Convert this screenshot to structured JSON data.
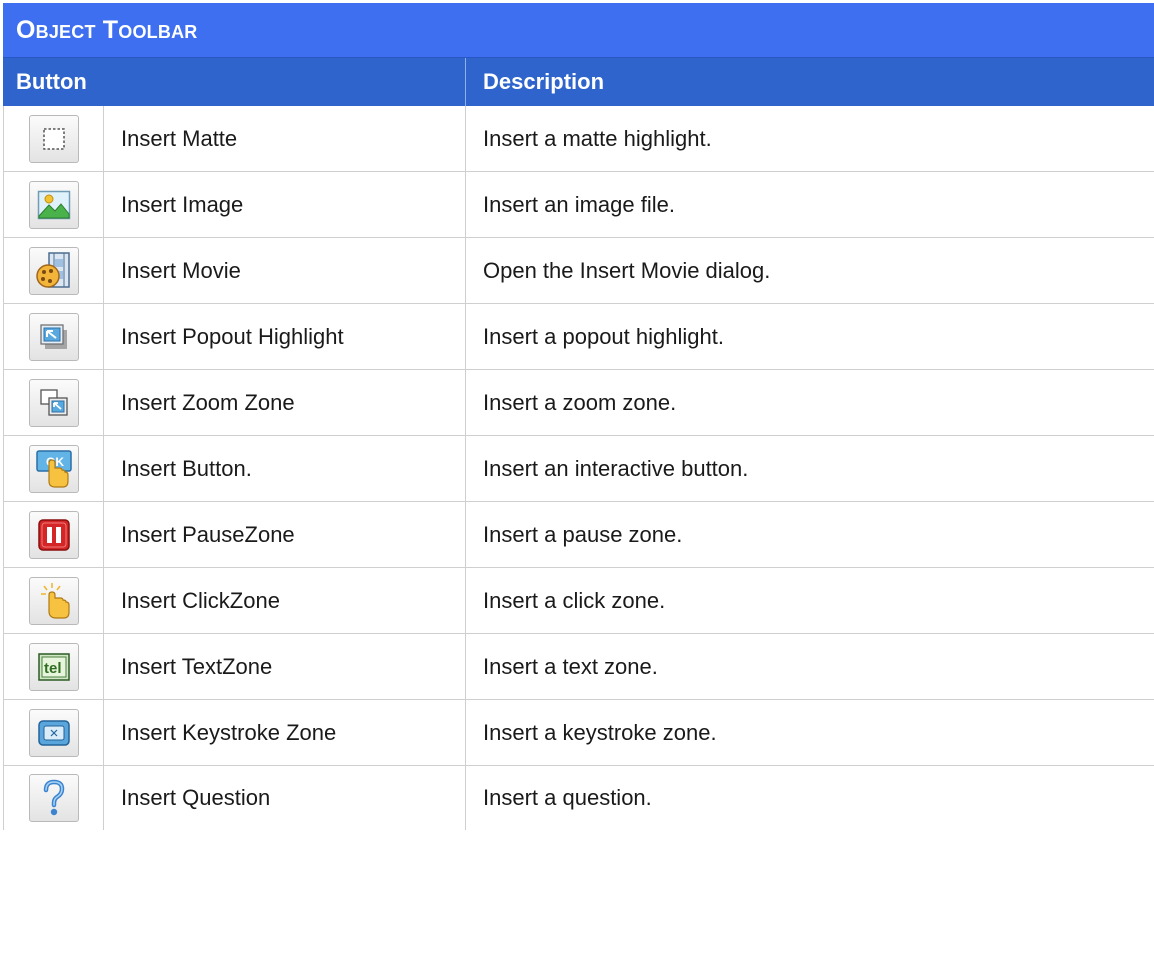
{
  "title": "Object Toolbar",
  "headers": {
    "button": "Button",
    "description": "Description"
  },
  "rows": [
    {
      "icon": "matte-icon",
      "label": "Insert Matte",
      "description": "Insert a matte highlight."
    },
    {
      "icon": "image-icon",
      "label": "Insert Image",
      "description": "Insert an image file."
    },
    {
      "icon": "movie-icon",
      "label": "Insert Movie",
      "description": "Open the Insert Movie dialog."
    },
    {
      "icon": "popout-highlight-icon",
      "label": "Insert Popout Highlight",
      "description": "Insert a popout highlight."
    },
    {
      "icon": "zoom-zone-icon",
      "label": "Insert Zoom Zone",
      "description": "Insert a zoom zone."
    },
    {
      "icon": "button-icon",
      "label": "Insert Button.",
      "description": "Insert an interactive button."
    },
    {
      "icon": "pause-zone-icon",
      "label": "Insert PauseZone",
      "description": "Insert a pause zone."
    },
    {
      "icon": "click-zone-icon",
      "label": "Insert ClickZone",
      "description": "Insert a click zone."
    },
    {
      "icon": "text-zone-icon",
      "label": "Insert TextZone",
      "description": "Insert a text zone."
    },
    {
      "icon": "keystroke-zone-icon",
      "label": "Insert Keystroke Zone",
      "description": "Insert a keystroke zone."
    },
    {
      "icon": "question-icon",
      "label": "Insert Question",
      "description": "Insert a question."
    }
  ],
  "icon_text": {
    "button_ok": "OK",
    "text_zone": "tel"
  },
  "colors": {
    "title_bg": "#3d6ff0",
    "header_bg": "#2e64cc",
    "border": "#cfcfcf"
  }
}
